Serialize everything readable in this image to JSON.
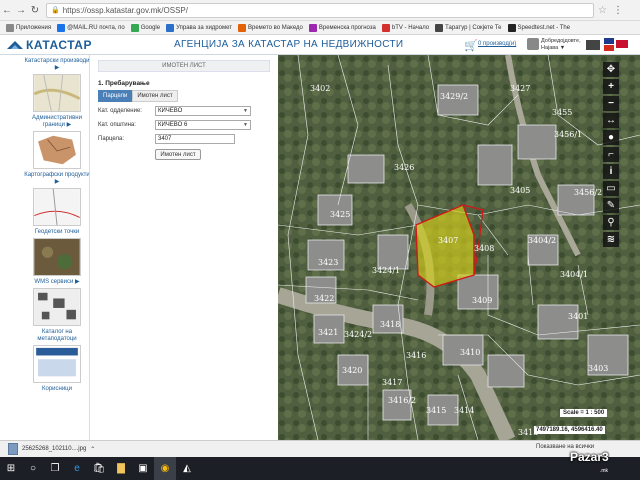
{
  "browser": {
    "url": "https://ossp.katastar.gov.mk/OSSP/",
    "bookmarks": [
      {
        "label": "Приложения",
        "color": "#888888"
      },
      {
        "label": "@MAIL.RU почта, по",
        "color": "#1a73e8"
      },
      {
        "label": "Google",
        "color": "#34a853"
      },
      {
        "label": "Управа за хидромет",
        "color": "#2a6fc9"
      },
      {
        "label": "Времето во Македо",
        "color": "#e36209"
      },
      {
        "label": "Временска прогноза",
        "color": "#9c27b0"
      },
      {
        "label": "bTV - Начало",
        "color": "#d32f2f"
      },
      {
        "label": "Таратур | Сокјете Те",
        "color": "#444444"
      },
      {
        "label": "Speedtest.net - The",
        "color": "#222222"
      }
    ]
  },
  "header": {
    "logo": "КАТАСТАР",
    "agency": "АГЕНЦИЈА ЗА КАТАСТАР НА НЕДВИЖНОСТИ",
    "cart_link": "0 производ(и)",
    "welcome_line1": "Добредојдовте,",
    "welcome_line2": "Најава ▼"
  },
  "sidebar": {
    "items": [
      {
        "label": "Катастарски производи ▶"
      },
      {
        "label": "Административни граници ▶"
      },
      {
        "label": "Картографски продукти ▶"
      },
      {
        "label": "Геодетски точки"
      },
      {
        "label": "WMS сервиси ▶"
      },
      {
        "label": "Каталог на метаподатоци"
      },
      {
        "label": "Корисници"
      }
    ]
  },
  "form": {
    "panel_title": "ИМОТЕН ЛИСТ",
    "step": "1. Пребарување",
    "tabs": [
      "Парцели",
      "Имотен лист"
    ],
    "fields": {
      "department_label": "Кат. одделение:",
      "department_value": "КИЧЕВО",
      "municipality_label": "Кат. општина:",
      "municipality_value": "КИЧЕВО 6",
      "parcel_label": "Парцела:",
      "parcel_value": "3407"
    },
    "button": "Имотен лист"
  },
  "map": {
    "scale": "Scale = 1 : 500",
    "coords": "7497189.16, 4596416.40",
    "highlight_color": "#f2e200",
    "parcel_labels": [
      "3426",
      "3425",
      "3424/1",
      "3407",
      "3408",
      "3409",
      "3410",
      "3405",
      "3404/2",
      "3423",
      "3422",
      "3421",
      "3424/2",
      "3418",
      "3416",
      "3420",
      "3417",
      "3416/2",
      "3415",
      "3414",
      "3413",
      "3401",
      "3402",
      "3403",
      "3429/2",
      "3427",
      "3455",
      "3456/1",
      "3456/2",
      "3404/1"
    ]
  },
  "downloads": {
    "file": "25625268_102110....jpg",
    "show_all": "Показване на всички"
  },
  "watermark": {
    "brand": "Pazar3",
    "sub": ".mk"
  }
}
